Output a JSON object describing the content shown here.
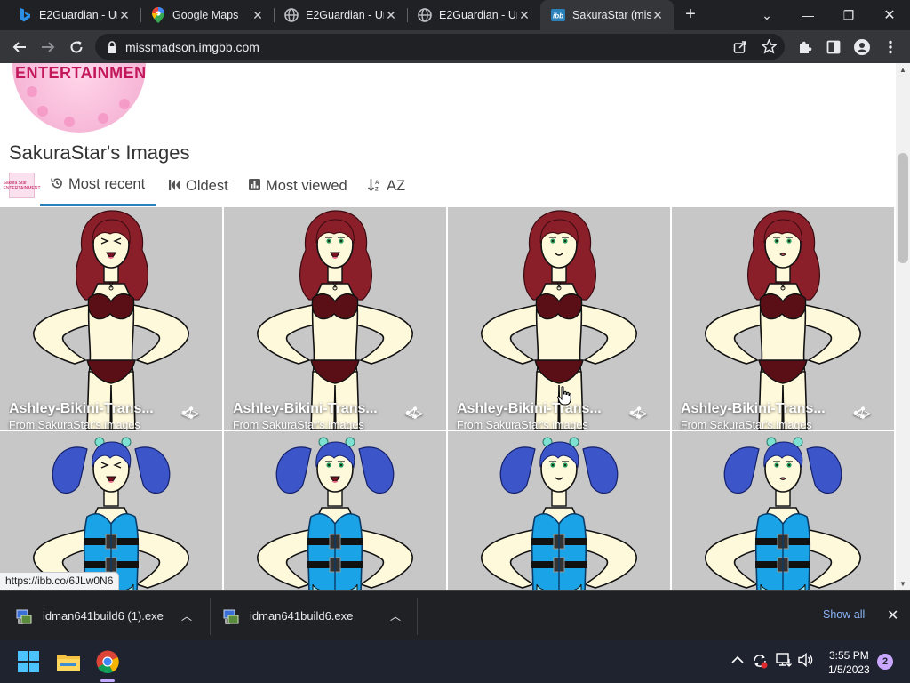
{
  "browser": {
    "tabs": [
      {
        "title": "E2Guardian - Un",
        "icon": "bing-icon"
      },
      {
        "title": "Google Maps",
        "icon": "google-maps-icon"
      },
      {
        "title": "E2Guardian - Un",
        "icon": "globe-icon"
      },
      {
        "title": "E2Guardian - Un",
        "icon": "globe-icon"
      },
      {
        "title": "SakuraStar (miss",
        "icon": "imgbb-icon",
        "active": true
      }
    ],
    "url": "missmadson.imgbb.com",
    "status_url": "https://ibb.co/6JLw0N6"
  },
  "page": {
    "logo_text": "ENTERTAINMEN",
    "title": "SakuraStar's Images",
    "avatar_text": "Sakura Star ENTERTAINMENT",
    "sorts": [
      {
        "label": "Most recent",
        "icon": "history-icon",
        "active": true
      },
      {
        "label": "Oldest",
        "icon": "skip-back-icon"
      },
      {
        "label": "Most viewed",
        "icon": "bar-chart-icon"
      },
      {
        "label": "AZ",
        "icon": "sort-alpha-icon"
      }
    ],
    "images": [
      {
        "title": "Ashley-Bikini-Trans...",
        "subtitle": "From SakuraStar's images",
        "expression": "laugh",
        "outfit": "bikini"
      },
      {
        "title": "Ashley-Bikini-Trans...",
        "subtitle": "From SakuraStar's images",
        "expression": "open",
        "outfit": "bikini"
      },
      {
        "title": "Ashley-Bikini-Trans...",
        "subtitle": "From SakuraStar's images",
        "expression": "smile",
        "outfit": "bikini"
      },
      {
        "title": "Ashley-Bikini-Trans...",
        "subtitle": "From SakuraStar's images",
        "expression": "worried",
        "outfit": "bikini"
      },
      {
        "title": "",
        "subtitle": "",
        "expression": "laugh",
        "outfit": "vest"
      },
      {
        "title": "",
        "subtitle": "",
        "expression": "open",
        "outfit": "vest"
      },
      {
        "title": "",
        "subtitle": "",
        "expression": "smile",
        "outfit": "vest"
      },
      {
        "title": "",
        "subtitle": "",
        "expression": "worried",
        "outfit": "vest"
      }
    ]
  },
  "downloads": {
    "items": [
      {
        "name": "idman641build6 (1).exe",
        "icon": "installer-icon"
      },
      {
        "name": "idman641build6.exe",
        "icon": "installer-icon"
      }
    ],
    "show_all": "Show all"
  },
  "taskbar": {
    "time": "3:55 PM",
    "date": "1/5/2023",
    "notifications": "2"
  },
  "colors": {
    "tabstrip": "#202124",
    "toolbar": "#35363a",
    "accent": "#2a80b9",
    "cell_bg": "#c7c7c7",
    "hair_red": "#8a1f2a",
    "hair_blue": "#3c55c8",
    "vest": "#1aa3e6",
    "bikini": "#5a0f16",
    "skin": "#fff9dc"
  }
}
